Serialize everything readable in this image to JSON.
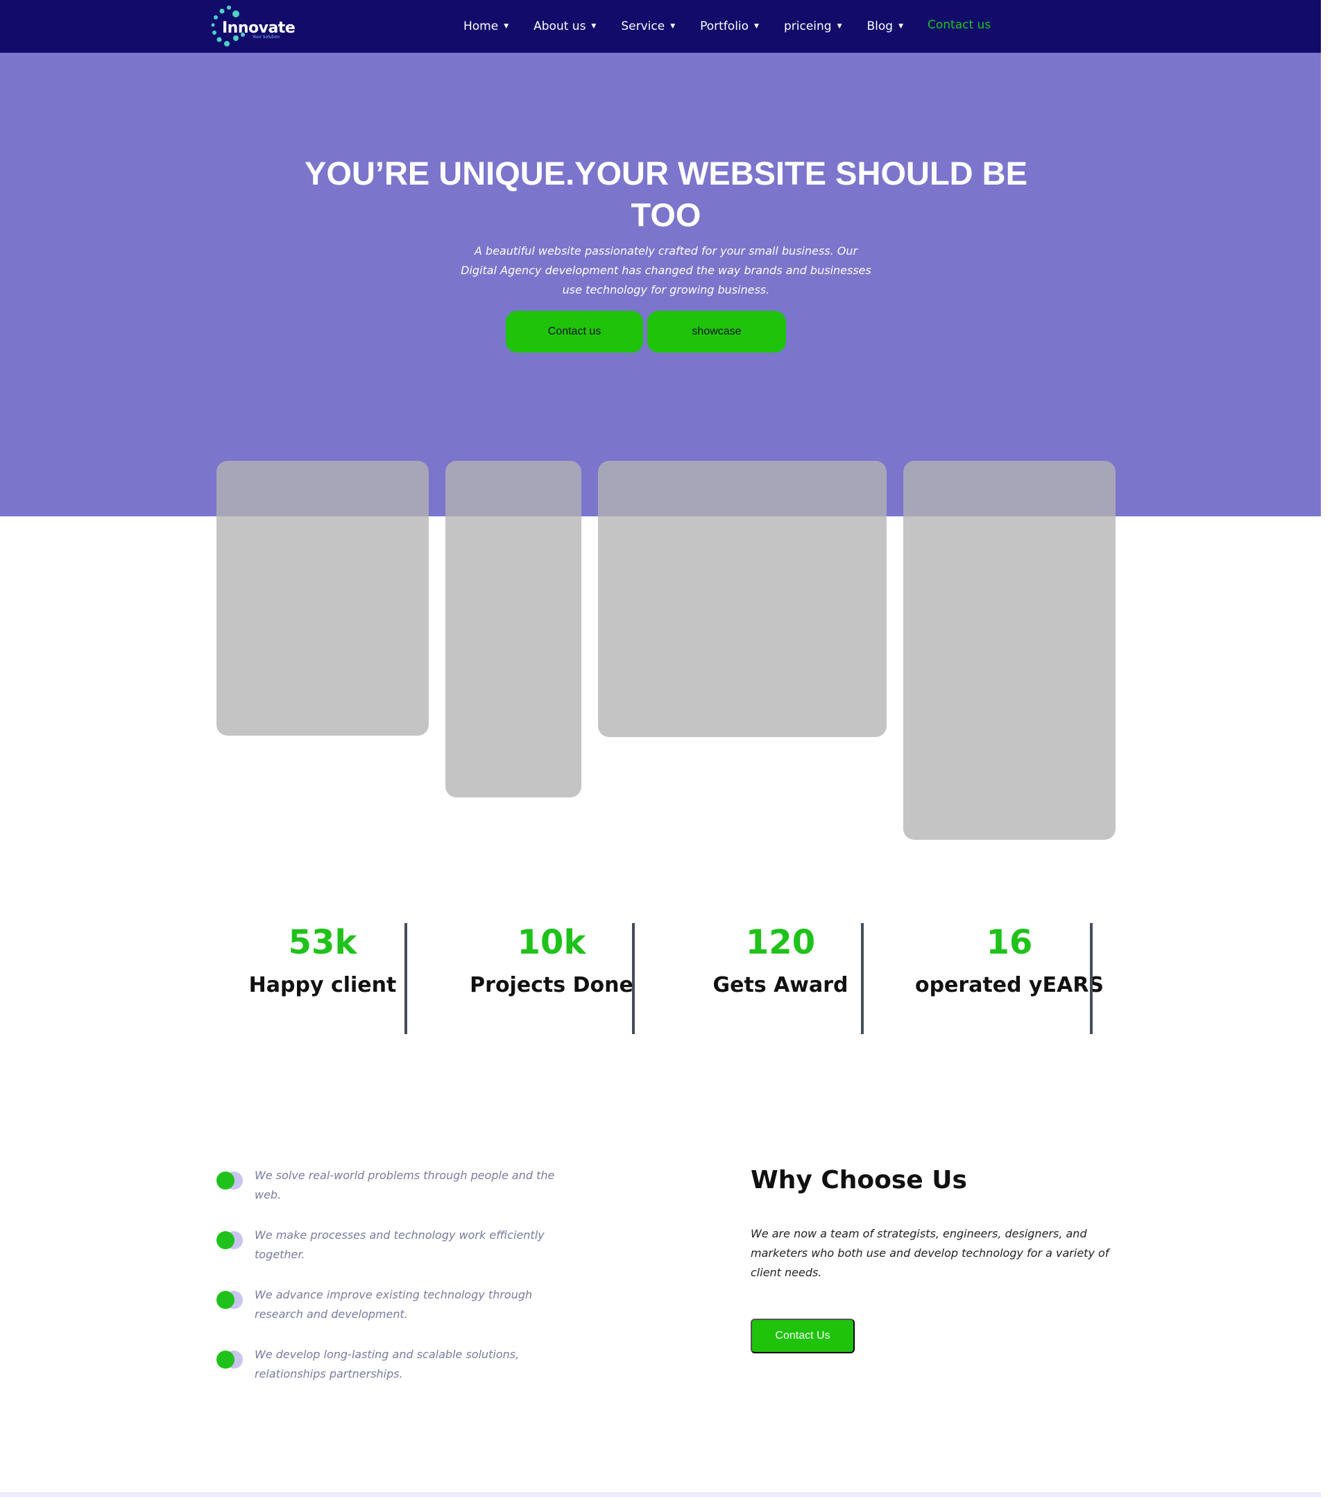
{
  "brand": {
    "name": "Innovate",
    "tagline": "Your Solution"
  },
  "nav": {
    "items": [
      {
        "label": "Home"
      },
      {
        "label": "About us"
      },
      {
        "label": "Service"
      },
      {
        "label": "Portfolio"
      },
      {
        "label": "priceing"
      },
      {
        "label": "Blog"
      }
    ],
    "contact_label": "Contact us"
  },
  "hero": {
    "title": "YOU’RE UNIQUE.YOUR WEBSITE SHOULD BE TOO",
    "subtitle": "A beautiful website passionately crafted for your small business. Our Digital Agency development has changed the way brands and businesses use technology for growing business.",
    "contact_button": "Contact us",
    "showcase_button": "showcase"
  },
  "stats": [
    {
      "value": "53k",
      "label": "Happy client"
    },
    {
      "value": "10k",
      "label": "Projects Done"
    },
    {
      "value": "120",
      "label": "Gets Award"
    },
    {
      "value": "16",
      "label": "operated yEARS"
    }
  ],
  "features": [
    {
      "text": "We solve real-world problems through people and the web."
    },
    {
      "text": "We make processes and technology work efficiently together."
    },
    {
      "text": "We advance improve existing technology through research and development."
    },
    {
      "text": "We develop long-lasting and scalable solutions, relationships partnerships."
    }
  ],
  "why": {
    "title": "Why Choose Us",
    "description": "We are now a team of strategists, engineers, designers, and marketers who both use and develop technology for a variety of client needs.",
    "button": "Contact Us"
  },
  "colors": {
    "navbar": "#110c6a",
    "hero": "#7b75cc",
    "accent_green": "#1ec30a",
    "card_gray": "#c4c4c4",
    "divider": "#454d59"
  },
  "icons": {
    "nav_caret": "caret-down-icon",
    "feature_bullet": "toggle-dot-icon",
    "logo": "dotted-circle-logo"
  }
}
